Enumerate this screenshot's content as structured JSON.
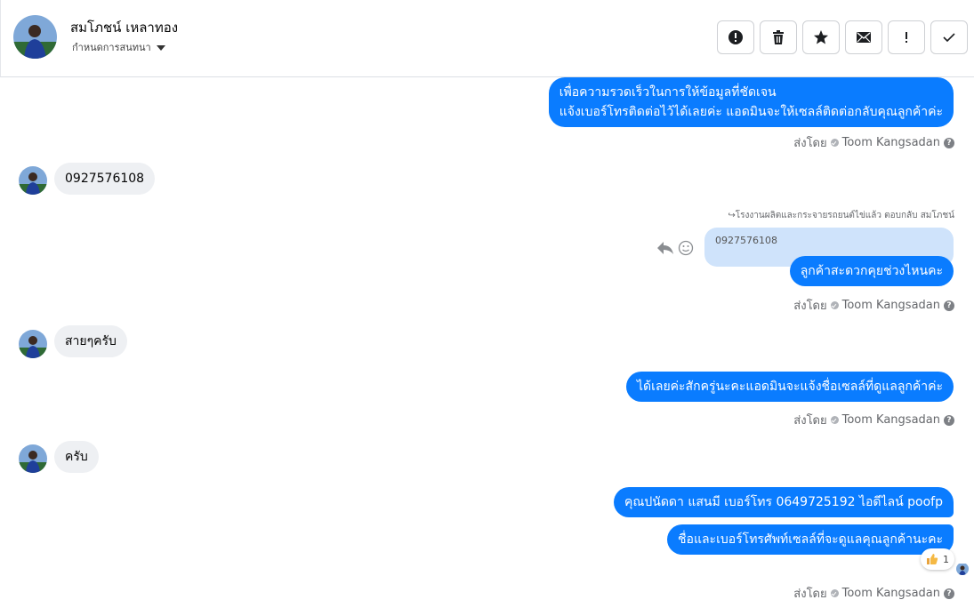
{
  "header": {
    "name": "สมโภชน์ เหลาทอง",
    "subtitle": "กำหนดการสนทนา",
    "buttons": [
      {
        "icon": "exclamation-circle-icon"
      },
      {
        "icon": "trash-icon"
      },
      {
        "icon": "star-icon"
      },
      {
        "icon": "envelope-icon"
      },
      {
        "icon": "exclamation-icon"
      },
      {
        "icon": "check-icon"
      }
    ]
  },
  "messages": {
    "m1_line1": "เพื่อความรวดเร็วในการให้ข้อมูลที่ชัดเจน",
    "m1_line2": "แจ้งเบอร์โทรติดต่อไว้ได้เลยค่ะ แอดมินจะให้เซลล์ติดต่อกลับคุณลูกค้าค่ะ",
    "m2": "0927576108",
    "reply_meta": "↪โรงงานผลิตและกระจายรถยนต์ไข่แล้ว ตอบกลับ สมโภชน์",
    "quoted": "0927576108",
    "m3": "ลูกค้าสะดวกคุยช่วงไหนคะ",
    "m4": "สายๆครับ",
    "m5": "ได้เลยค่ะสักครู่นะคะแอดมินจะแจ้งชื่อเซลล์ที่ดูแลลูกค้าค่ะ",
    "m6": "ครับ",
    "m7": "คุณปนัดดา แสนมี   เบอร์โทร 0649725192  ไอดีไลน์ poofp",
    "m8": "ชื่อและเบอร์โทรศัพท์เซลล์ที่จะดูแลคุณลูกค้านะคะ",
    "reaction_count": "1"
  },
  "sent_by": {
    "prefix": "ส่งโดย",
    "agent": "Toom Kangsadan"
  },
  "colors": {
    "outgoing": "#0a7cff",
    "incoming": "#eef0f3",
    "quoted": "#cfe3fb"
  }
}
